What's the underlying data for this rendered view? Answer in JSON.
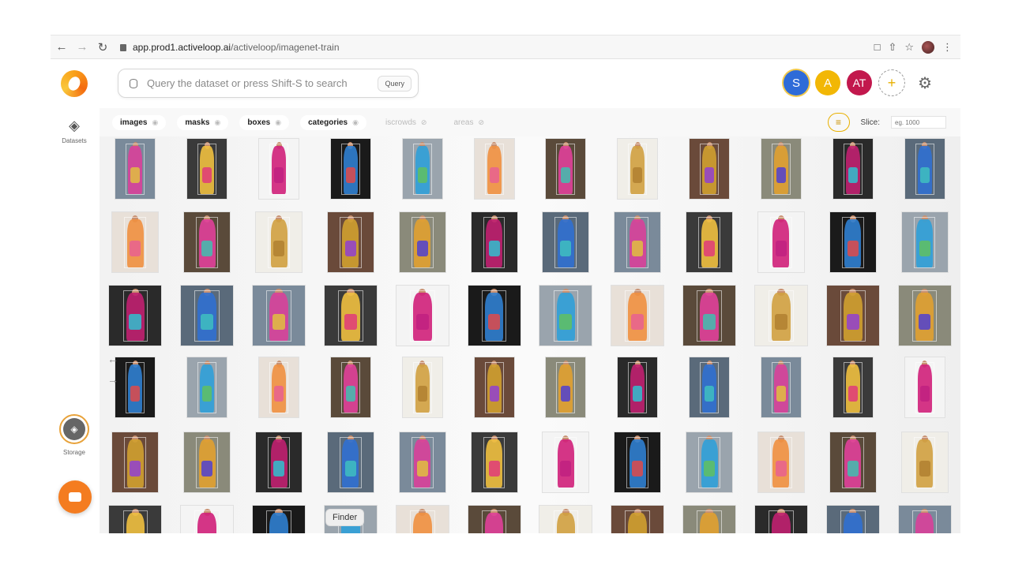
{
  "browser": {
    "url_host": "app.prod1.activeloop.ai",
    "url_path": "/activeloop/imagenet-train"
  },
  "search": {
    "placeholder": "Query the dataset or press Shift-S to search",
    "query_label": "Query"
  },
  "users": [
    {
      "initials": "S",
      "color": "#2e6bd8"
    },
    {
      "initials": "A",
      "color": "#f2b705"
    },
    {
      "initials": "AT",
      "color": "#c2184d"
    }
  ],
  "add_user_symbol": "+",
  "sidebar": {
    "datasets_label": "Datasets",
    "storage_label": "Storage"
  },
  "filters": {
    "active": [
      "images",
      "masks",
      "boxes",
      "categories"
    ],
    "inactive": [
      "iscrowds",
      "areas"
    ],
    "slice_label": "Slice:",
    "slice_placeholder": "eg. 1000"
  },
  "finder_label": "Finder",
  "accent_color": "#f47c20",
  "grid": {
    "columns": 12,
    "rows": 6,
    "palette": [
      [
        "#7a8a9a",
        "#d8409a",
        "#e0c040"
      ],
      [
        "#3a3a3a",
        "#f0c040",
        "#e03a7a"
      ],
      [
        "#f4f4f4",
        "#d0207a",
        "#c02080"
      ],
      [
        "#1a1a1a",
        "#3080d0",
        "#e04a4a"
      ],
      [
        "#9aa4ad",
        "#30a0d8",
        "#60c060"
      ],
      [
        "#e8e0d8",
        "#f09040",
        "#e86090"
      ],
      [
        "#5a4a3a",
        "#e0409a",
        "#40c0b0"
      ],
      [
        "#f0eee8",
        "#d0a040",
        "#b08030"
      ],
      [
        "#6a4a3a",
        "#d0a030",
        "#9040d0"
      ],
      [
        "#8a8a7a",
        "#e0a030",
        "#5040d0"
      ],
      [
        "#2a2a2a",
        "#c02070",
        "#30c0d0"
      ],
      [
        "#5a6a7a",
        "#3070d0",
        "#40c0c0"
      ]
    ]
  }
}
